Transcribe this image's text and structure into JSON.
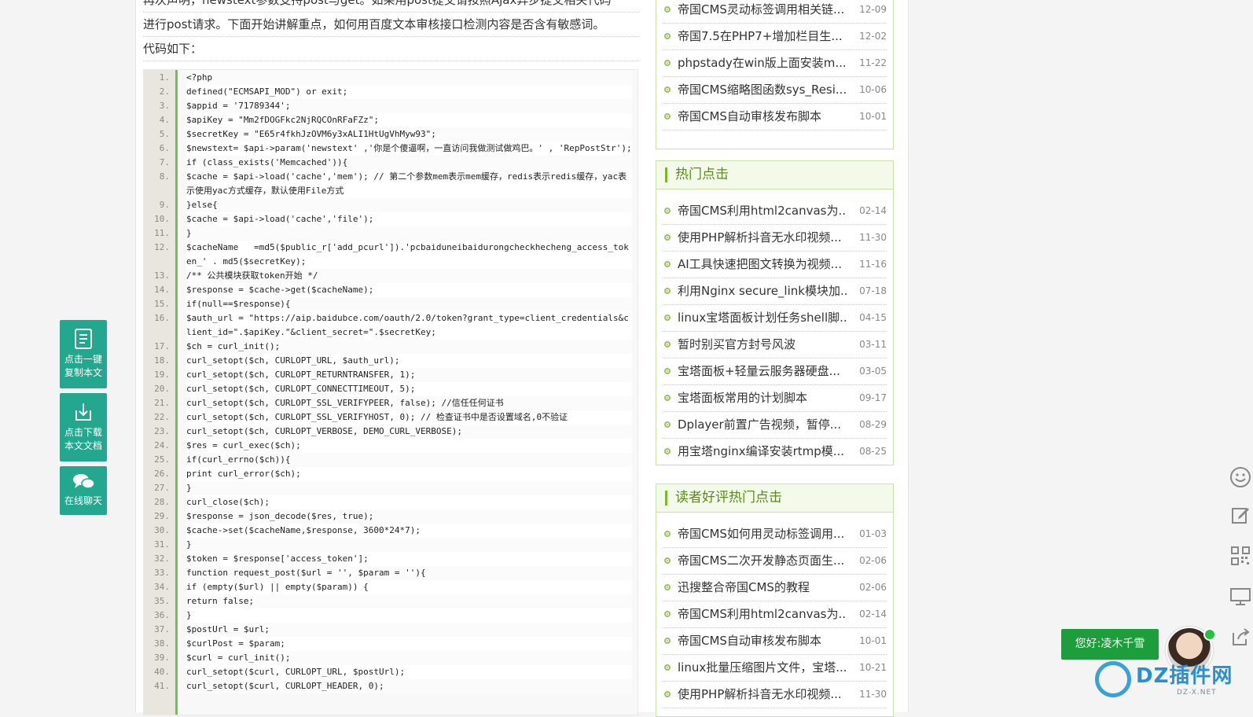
{
  "article": {
    "intro_line1": "再次声明，newstext参数支持post与get。如果用post提交请按照Ajax异步提交相关代码",
    "intro_line2": "进行post请求。下面开始讲解重点，如何用百度文本审核接口检测内容是否含有敏感词。",
    "intro_line3": "代码如下："
  },
  "code_lines": [
    {
      "n": "1.",
      "t": "<?php"
    },
    {
      "n": "2.",
      "t": "defined(\"ECMSAPI_MOD\") or exit;"
    },
    {
      "n": "3.",
      "t": "$appid = '71789344';"
    },
    {
      "n": "4.",
      "t": "$apiKey = \"Mm2fDOGFkc2NjRQCOnRFaFZz\";"
    },
    {
      "n": "5.",
      "t": "$secretKey = \"E65r4fkhJzOVM6y3xALI1HtUgVhMyw93\";"
    },
    {
      "n": "6.",
      "t": "$newstext= $api->param('newstext' ,'你是个傻逼啊，一直访问我做测试做鸡巴。' , 'RepPostStr');"
    },
    {
      "n": "7.",
      "t": "if (class_exists('Memcached')){"
    },
    {
      "n": "8.",
      "t": "$cache = $api->load('cache','mem'); // 第二个参数mem表示mem缓存，redis表示redis缓存，yac表示使用yac方式缓存，默认使用File方式"
    },
    {
      "n": "9.",
      "t": "}else{"
    },
    {
      "n": "10.",
      "t": "$cache = $api->load('cache','file');"
    },
    {
      "n": "11.",
      "t": "}"
    },
    {
      "n": "12.",
      "t": "$cacheName   =md5($public_r['add_pcurl']).'pcbaiduneibaidurongcheckhecheng_access_token_' . md5($secretKey);"
    },
    {
      "n": "13.",
      "t": "/** 公共模块获取token开始 */"
    },
    {
      "n": "14.",
      "t": "$response = $cache->get($cacheName);"
    },
    {
      "n": "15.",
      "t": "if(null==$response){"
    },
    {
      "n": "16.",
      "t": "$auth_url = \"https://aip.baidubce.com/oauth/2.0/token?grant_type=client_credentials&client_id=\".$apiKey.\"&client_secret=\".$secretKey;"
    },
    {
      "n": "17.",
      "t": "$ch = curl_init();"
    },
    {
      "n": "18.",
      "t": "curl_setopt($ch, CURLOPT_URL, $auth_url);"
    },
    {
      "n": "19.",
      "t": "curl_setopt($ch, CURLOPT_RETURNTRANSFER, 1);"
    },
    {
      "n": "20.",
      "t": "curl_setopt($ch, CURLOPT_CONNECTTIMEOUT, 5);"
    },
    {
      "n": "21.",
      "t": "curl_setopt($ch, CURLOPT_SSL_VERIFYPEER, false); //信任任何证书"
    },
    {
      "n": "22.",
      "t": "curl_setopt($ch, CURLOPT_SSL_VERIFYHOST, 0); // 检查证书中是否设置域名,0不验证"
    },
    {
      "n": "23.",
      "t": "curl_setopt($ch, CURLOPT_VERBOSE, DEMO_CURL_VERBOSE);"
    },
    {
      "n": "24.",
      "t": "$res = curl_exec($ch);"
    },
    {
      "n": "25.",
      "t": "if(curl_errno($ch)){"
    },
    {
      "n": "26.",
      "t": "print curl_error($ch);"
    },
    {
      "n": "27.",
      "t": "}"
    },
    {
      "n": "28.",
      "t": "curl_close($ch);"
    },
    {
      "n": "29.",
      "t": "$response = json_decode($res, true);"
    },
    {
      "n": "30.",
      "t": "$cache->set($cacheName,$response, 3600*24*7);"
    },
    {
      "n": "31.",
      "t": "}"
    },
    {
      "n": "32.",
      "t": "$token = $response['access_token'];"
    },
    {
      "n": "33.",
      "t": "function request_post($url = '', $param = ''){"
    },
    {
      "n": "34.",
      "t": "if (empty($url) || empty($param)) {"
    },
    {
      "n": "35.",
      "t": "return false;"
    },
    {
      "n": "36.",
      "t": "}"
    },
    {
      "n": "37.",
      "t": "$postUrl = $url;"
    },
    {
      "n": "38.",
      "t": "$curlPost = $param;"
    },
    {
      "n": "39.",
      "t": "$curl = curl_init();"
    },
    {
      "n": "40.",
      "t": "curl_setopt($curl, CURLOPT_URL, $postUrl);"
    },
    {
      "n": "41.",
      "t": "curl_setopt($curl, CURLOPT_HEADER, 0);"
    }
  ],
  "sidebar": {
    "top_list": [
      {
        "title": "帝国CMS灵动标签调用相关链...",
        "date": "12-09"
      },
      {
        "title": "帝国7.5在PHP7+增加栏目生...",
        "date": "12-02"
      },
      {
        "title": "phpstady在win版上面安装m...",
        "date": "11-22"
      },
      {
        "title": "帝国CMS缩略图函数sys_Resi...",
        "date": "10-06"
      },
      {
        "title": "帝国CMS自动审核发布脚本",
        "date": "10-01"
      }
    ],
    "hot_title": "热门点击",
    "hot_list": [
      {
        "title": "帝国CMS利用html2canvas为...",
        "date": "02-14"
      },
      {
        "title": "使用PHP解析抖音无水印视频...",
        "date": "11-30"
      },
      {
        "title": "AI工具快速把图文转换为视频...",
        "date": "11-16"
      },
      {
        "title": "利用Nginx secure_link模块加...",
        "date": "07-18"
      },
      {
        "title": "linux宝塔面板计划任务shell脚...",
        "date": "04-15"
      },
      {
        "title": "暂时别买官方封号风波",
        "date": "03-11"
      },
      {
        "title": "宝塔面板+轻量云服务器硬盘...",
        "date": "03-05"
      },
      {
        "title": "宝塔面板常用的计划脚本",
        "date": "09-17"
      },
      {
        "title": "Dplayer前置广告视频，暂停...",
        "date": "08-29"
      },
      {
        "title": "用宝塔nginx编译安装rtmp模...",
        "date": "08-25"
      }
    ],
    "review_title": "读者好评热门点击",
    "review_list": [
      {
        "title": "帝国CMS如何用灵动标签调用...",
        "date": "01-03"
      },
      {
        "title": "帝国CMS二次开发静态页面生...",
        "date": "02-06"
      },
      {
        "title": "迅搜整合帝国CMS的教程",
        "date": "02-06"
      },
      {
        "title": "帝国CMS利用html2canvas为...",
        "date": "02-14"
      },
      {
        "title": "帝国CMS自动审核发布脚本",
        "date": "10-01"
      },
      {
        "title": "linux批量压缩图片文件，宝塔...",
        "date": "10-21"
      },
      {
        "title": "使用PHP解析抖音无水印视频...",
        "date": "11-30"
      }
    ]
  },
  "float_buttons": {
    "copy": {
      "line1": "点击一键",
      "line2": "复制本文",
      "icon": "document-icon"
    },
    "download": {
      "line1": "点击下载",
      "line2": "本文文档",
      "icon": "download-icon"
    },
    "chat": {
      "line1": "在线聊天",
      "icon": "chat-icon"
    }
  },
  "right_toolbar": [
    "smile-icon",
    "edit-icon",
    "qrcode-icon",
    "monitor-icon",
    "share-icon"
  ],
  "greeting": "您好:凌木千雪",
  "watermark": {
    "logo": "DZ插件网",
    "sub": "DZ-X.NET"
  },
  "colors": {
    "accent": "#6ac259",
    "button": "#24a78f",
    "box_border": "#c9e2a9",
    "greet": "#1e9d3c"
  }
}
